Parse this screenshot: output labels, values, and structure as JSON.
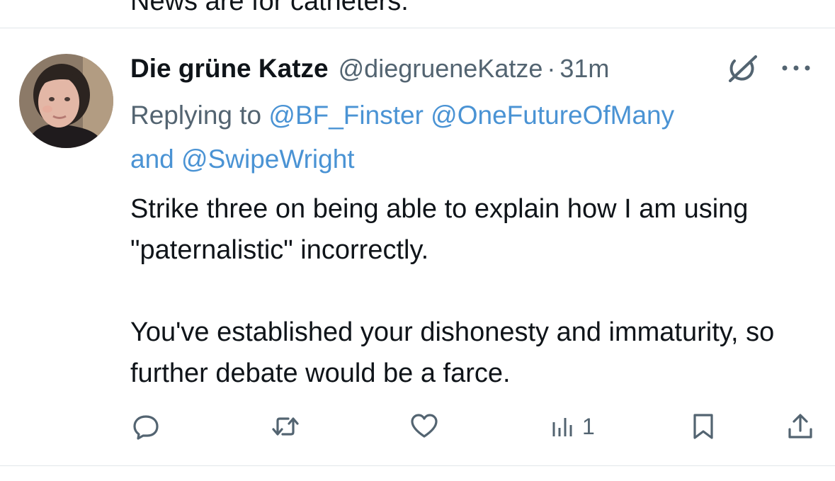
{
  "previous_tweet": {
    "text": "News are for catheters."
  },
  "tweet": {
    "display_name": "Die grüne Katze",
    "handle": "@diegrueneKatze",
    "separator": "·",
    "time": "31m",
    "replying_to_label": "Replying to",
    "mentions": [
      "@BF_Finster",
      "@OneFutureOfMany",
      "@SwipeWright"
    ],
    "mention_joiner": "and",
    "paragraphs": [
      "Strike three on being able to explain how I am using \"paternalistic\" incorrectly.",
      "You've established your dishonesty and immaturity, so further debate would be a farce."
    ]
  },
  "actions": {
    "views_count": "1"
  },
  "icons": [
    "reply-icon",
    "retweet-icon",
    "like-icon",
    "views-icon",
    "bookmark-icon",
    "share-icon",
    "grok-icon",
    "more-icon"
  ],
  "colors": {
    "text": "#0f1419",
    "secondary": "#536471",
    "link": "#4a93d4",
    "divider": "#e1e6ea"
  }
}
